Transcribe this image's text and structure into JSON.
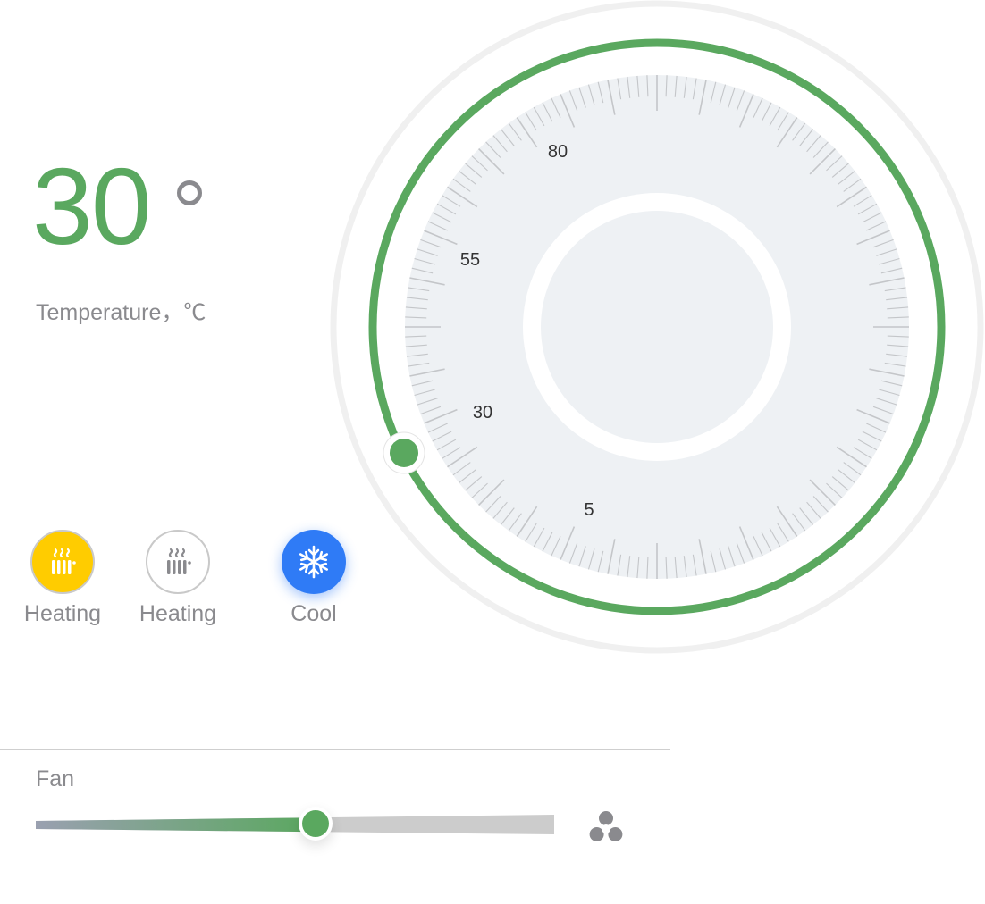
{
  "temperature": {
    "value": "30",
    "label": "Temperature，℃",
    "degree_symbol": "°"
  },
  "dial": {
    "scale_labels": [
      "80",
      "55",
      "30",
      "5"
    ],
    "current_value": 30,
    "active_color": "#5aa85f",
    "track_color": "#f0f0f0",
    "face_color": "#eef1f4",
    "tick_color": "#c4c6c9"
  },
  "modes": [
    {
      "label": "Heating",
      "icon": "radiator-icon",
      "state": "active",
      "color": "#ffcc00"
    },
    {
      "label": "Heating",
      "icon": "radiator-icon",
      "state": "inactive",
      "color": "#ffffff"
    },
    {
      "label": "Cool",
      "icon": "snowflake-icon",
      "state": "selected",
      "color": "#2f7bf6"
    }
  ],
  "fan": {
    "label": "Fan",
    "level": 0.54,
    "icon": "fan-icon",
    "active_color": "#5aa85f"
  }
}
